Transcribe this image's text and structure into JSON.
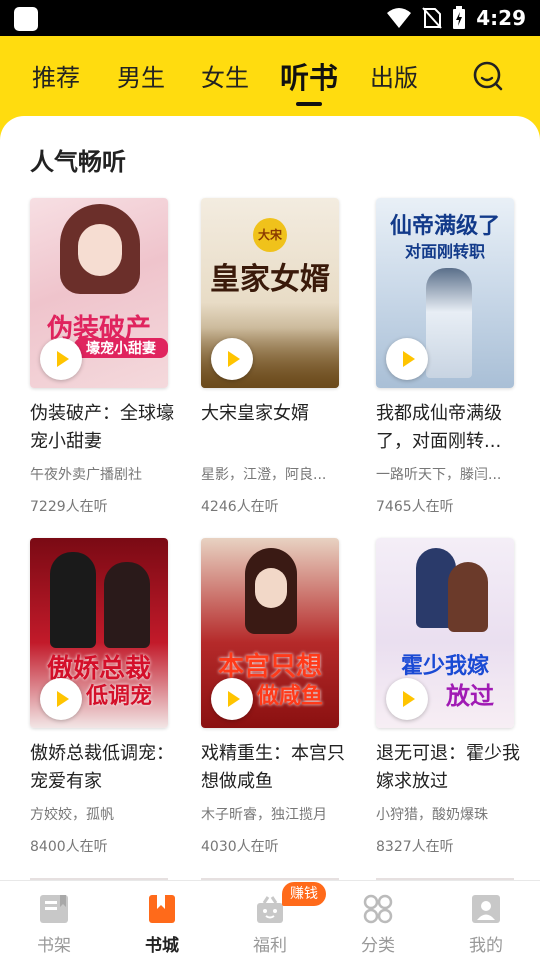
{
  "status_bar": {
    "time": "4:29"
  },
  "top_nav": {
    "tabs": [
      {
        "label": "推荐"
      },
      {
        "label": "男生"
      },
      {
        "label": "女生"
      },
      {
        "label": "听书"
      },
      {
        "label": "出版"
      }
    ],
    "active_tab": "听书"
  },
  "section": {
    "title": "人气畅听"
  },
  "books": [
    {
      "title": "伪装破产：全球壕宠小甜妻",
      "author": "午夜外卖广播剧社",
      "listeners": "7229人在听",
      "cover_text": "伪装破产",
      "cover_sub": "壕宠小甜妻"
    },
    {
      "title": "大宋皇家女婿",
      "author": "星影，江澄，阿良...",
      "listeners": "4246人在听",
      "cover_text": "皇家女婿",
      "cover_sub": "大宋"
    },
    {
      "title": "我都成仙帝满级了，对面刚转...",
      "author": "一路听天下，滕闫...",
      "listeners": "7465人在听",
      "cover_text": "仙帝满级了",
      "cover_sub": "对面刚转职"
    },
    {
      "title": "傲娇总裁低调宠：宠爱有家",
      "author": "方姣姣，孤帆",
      "listeners": "8400人在听",
      "cover_text": "傲娇总裁",
      "cover_sub": "低调宠"
    },
    {
      "title": "戏精重生：本宫只想做咸鱼",
      "author": "木子昕睿，独江揽月",
      "listeners": "4030人在听",
      "cover_text": "本宫只想",
      "cover_sub": "做咸鱼"
    },
    {
      "title": "退无可退：霍少我嫁求放过",
      "author": "小狩猎，酸奶爆珠",
      "listeners": "8327人在听",
      "cover_text": "霍少我嫁",
      "cover_sub": "放过"
    }
  ],
  "bottom_nav": {
    "items": [
      {
        "label": "书架",
        "icon": "bookshelf-icon"
      },
      {
        "label": "书城",
        "icon": "bookstore-icon"
      },
      {
        "label": "福利",
        "icon": "gift-icon"
      },
      {
        "label": "分类",
        "icon": "category-icon"
      },
      {
        "label": "我的",
        "icon": "profile-icon"
      }
    ],
    "active": "书城",
    "earn_badge": "赚钱"
  },
  "colors": {
    "brand_yellow": "#ffdc0f",
    "badge_orange": "#ff6a1a"
  }
}
